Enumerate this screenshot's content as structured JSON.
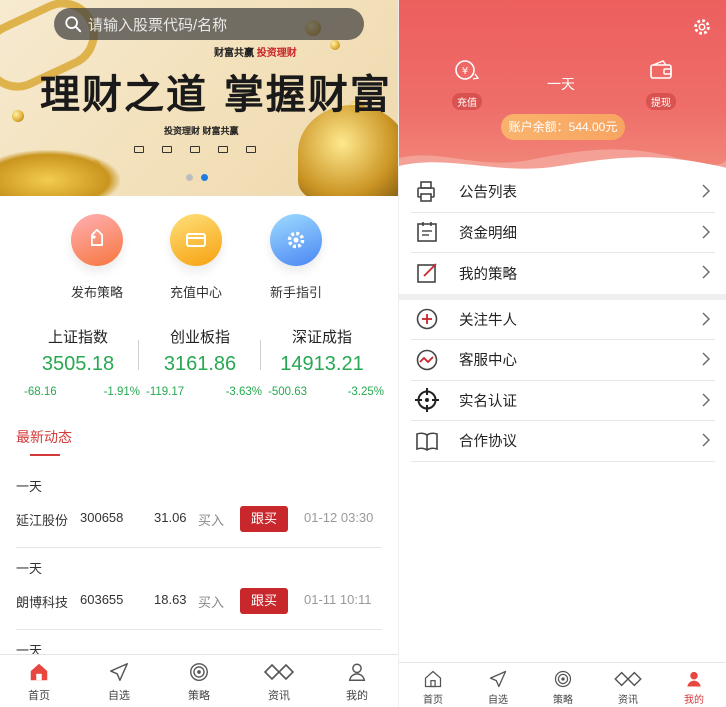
{
  "left": {
    "search": {
      "placeholder": "请输入股票代码/名称",
      "icon": "search-icon"
    },
    "banner": {
      "subtitle_1": "财富共赢",
      "subtitle_2": "投资理财",
      "headline": "理财之道 掌握财富",
      "tagline": "投资理财 财富共赢",
      "pager_active": 1,
      "pager_count": 2
    },
    "quick_actions": [
      {
        "label": "发布策略",
        "icon": "tag-icon",
        "color_top": "#ff9aa0",
        "color_bottom": "#f77b3e"
      },
      {
        "label": "充值中心",
        "icon": "card-icon",
        "color_top": "#ffd65a",
        "color_bottom": "#f7a312"
      },
      {
        "label": "新手指引",
        "icon": "gear-icon",
        "color_top": "#8fd2ff",
        "color_bottom": "#4b8cf5"
      }
    ],
    "indices": [
      {
        "name": "上证指数",
        "value": "3505.18",
        "change": "-68.16",
        "pct": "-1.91%"
      },
      {
        "name": "创业板指",
        "value": "3161.86",
        "change": "-119.17",
        "pct": "-3.63%"
      },
      {
        "name": "深证成指",
        "value": "14913.21",
        "change": "-500.63",
        "pct": "-3.25%"
      }
    ],
    "news_title": "最新动态",
    "feed": [
      {
        "user": "一天",
        "stock": "延江股份",
        "code": "300658",
        "price": "31.06",
        "action": "买入",
        "button": "跟买",
        "time": "01-12 03:30"
      },
      {
        "user": "一天",
        "stock": "朗博科技",
        "code": "603655",
        "price": "18.63",
        "action": "买入",
        "button": "跟买",
        "time": "01-11 10:11"
      },
      {
        "user": "一天"
      }
    ],
    "tabs": [
      {
        "label": "首页",
        "icon": "home-icon",
        "active": true
      },
      {
        "label": "自选",
        "icon": "send-icon",
        "active": false
      },
      {
        "label": "策略",
        "icon": "target-icon",
        "active": false
      },
      {
        "label": "资讯",
        "icon": "link-icon",
        "active": false
      },
      {
        "label": "我的",
        "icon": "user-icon",
        "active": false
      }
    ]
  },
  "right": {
    "header": {
      "recharge_label": "充值",
      "withdraw_label": "提现",
      "username": "一天",
      "balance": "账户余额：544.00元",
      "settings_icon": "gear-icon"
    },
    "menu": [
      {
        "label": "公告列表",
        "icon": "printer-icon"
      },
      {
        "label": "资金明细",
        "icon": "calendar-icon"
      },
      {
        "label": "我的策略",
        "icon": "edit-icon"
      },
      {
        "label": "关注牛人",
        "icon": "plus-circle-icon"
      },
      {
        "label": "客服中心",
        "icon": "wave-circle-icon"
      },
      {
        "label": "实名认证",
        "icon": "crosshair-icon"
      },
      {
        "label": "合作协议",
        "icon": "book-icon"
      }
    ],
    "tabs": [
      {
        "label": "首页",
        "icon": "home-icon",
        "active": false
      },
      {
        "label": "自选",
        "icon": "send-icon",
        "active": false
      },
      {
        "label": "策略",
        "icon": "target-icon",
        "active": false
      },
      {
        "label": "资讯",
        "icon": "link-icon",
        "active": false
      },
      {
        "label": "我的",
        "icon": "user-icon",
        "active": true
      }
    ]
  },
  "colors": {
    "accent_red": "#d33b3b",
    "button_red": "#c8282c",
    "index_green": "#27a852",
    "header_red": "#ec5f5e",
    "balance_orange": "#f8ac66"
  }
}
